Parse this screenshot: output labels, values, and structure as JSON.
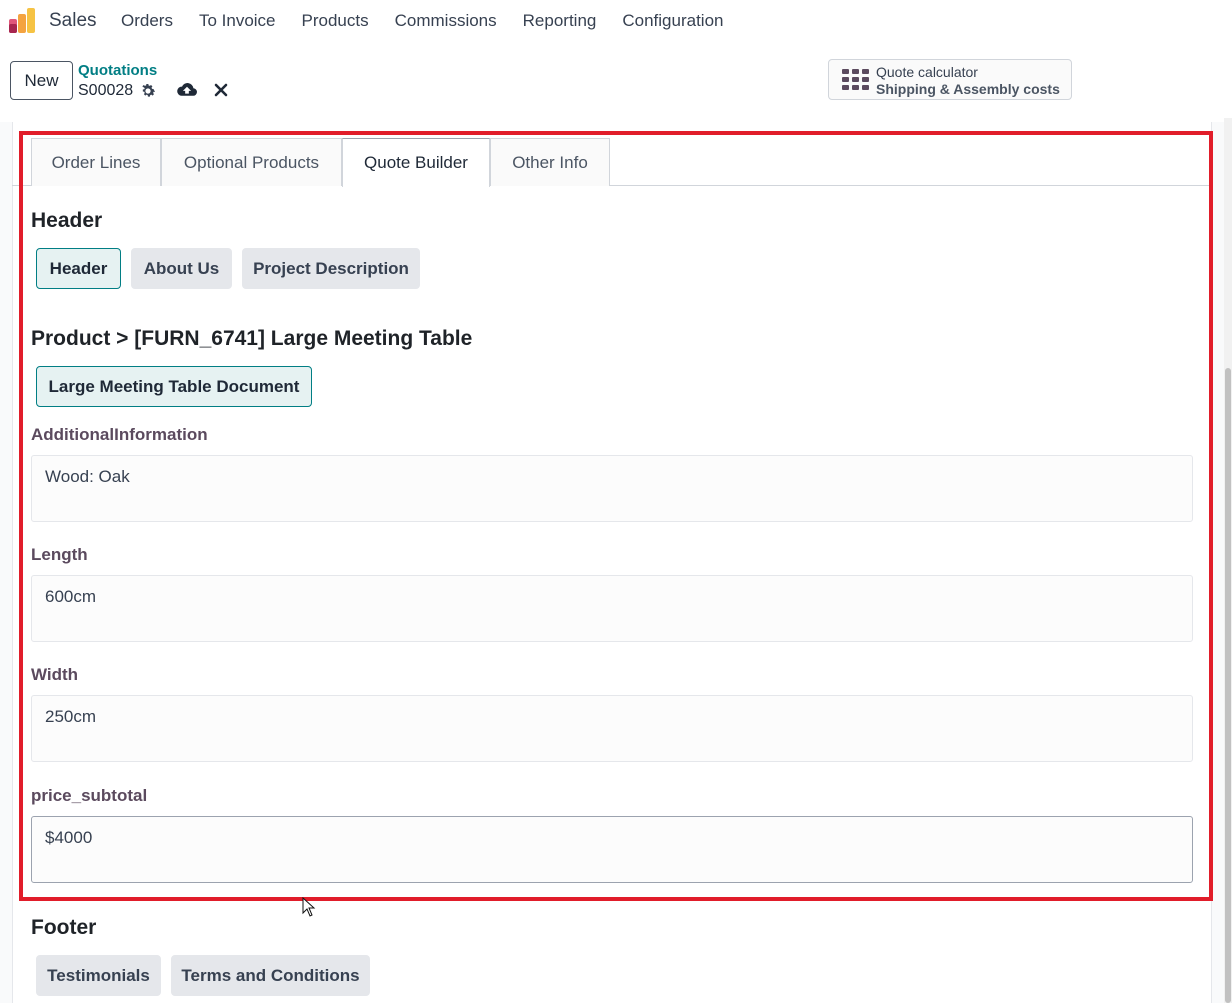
{
  "navbar": {
    "app_name": "Sales",
    "menu": [
      "Orders",
      "To Invoice",
      "Products",
      "Commissions",
      "Reporting",
      "Configuration"
    ]
  },
  "control_panel": {
    "new_label": "New",
    "breadcrumb_parent": "Quotations",
    "record_name": "S00028",
    "icons": [
      "gear-icon",
      "cloud-upload-icon",
      "close-icon"
    ],
    "calculator": {
      "icon": "grid-icon",
      "title": "Quote calculator",
      "subtitle": "Shipping & Assembly costs"
    }
  },
  "tabs": [
    "Order Lines",
    "Optional Products",
    "Quote Builder",
    "Other Info"
  ],
  "active_tab": "Quote Builder",
  "quote_builder": {
    "header_title": "Header",
    "header_buttons": [
      "Header",
      "About Us",
      "Project Description"
    ],
    "product_title": "Product > [FURN_6741] Large Meeting Table",
    "product_document": "Large Meeting Table Document",
    "fields": [
      {
        "label": "AdditionalInformation",
        "value": "Wood: Oak"
      },
      {
        "label": "Length",
        "value": "600cm"
      },
      {
        "label": "Width",
        "value": "250cm"
      },
      {
        "label": "price_subtotal",
        "value": "$4000"
      }
    ],
    "footer_title": "Footer",
    "footer_buttons": [
      "Testimonials",
      "Terms and Conditions"
    ]
  },
  "colors": {
    "accent": "#017e84",
    "highlight": "#e11d2a"
  }
}
